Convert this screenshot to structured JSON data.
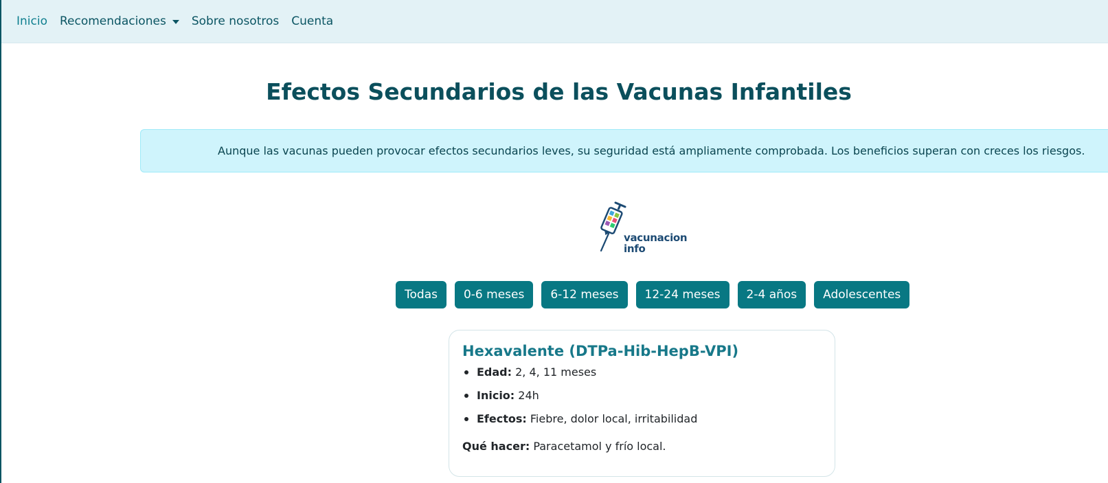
{
  "nav": {
    "inicio": "Inicio",
    "recomendaciones": "Recomendaciones",
    "sobre": "Sobre nosotros",
    "cuenta": "Cuenta"
  },
  "page_title": "Efectos Secundarios de las Vacunas Infantiles",
  "alert_text": "Aunque las vacunas pueden provocar efectos secundarios leves, su seguridad está ampliamente comprobada. Los beneficios superan con creces los riesgos.",
  "logo": {
    "line1": "vacunacion",
    "line2": "info",
    "icon": "syringe-icon"
  },
  "filters": [
    "Todas",
    "0-6 meses",
    "6-12 meses",
    "12-24 meses",
    "2-4 años",
    "Adolescentes"
  ],
  "card": {
    "title": "Hexavalente (DTPa-Hib-HepB-VPI)",
    "edad_label": "Edad:",
    "edad_value": " 2, 4, 11 meses",
    "inicio_label": "Inicio:",
    "inicio_value": " 24h",
    "efectos_label": "Efectos:",
    "efectos_value": " Fiebre, dolor local, irritabilidad",
    "action_label": "Qué hacer:",
    "action_value": " Paracetamol y frío local."
  },
  "colors": {
    "navbar_bg": "#e3f2f6",
    "nav_text": "#0b5563",
    "title": "#0b4f5c",
    "alert_bg": "#cff4fc",
    "filter_btn": "#087883",
    "card_title": "#177889"
  }
}
